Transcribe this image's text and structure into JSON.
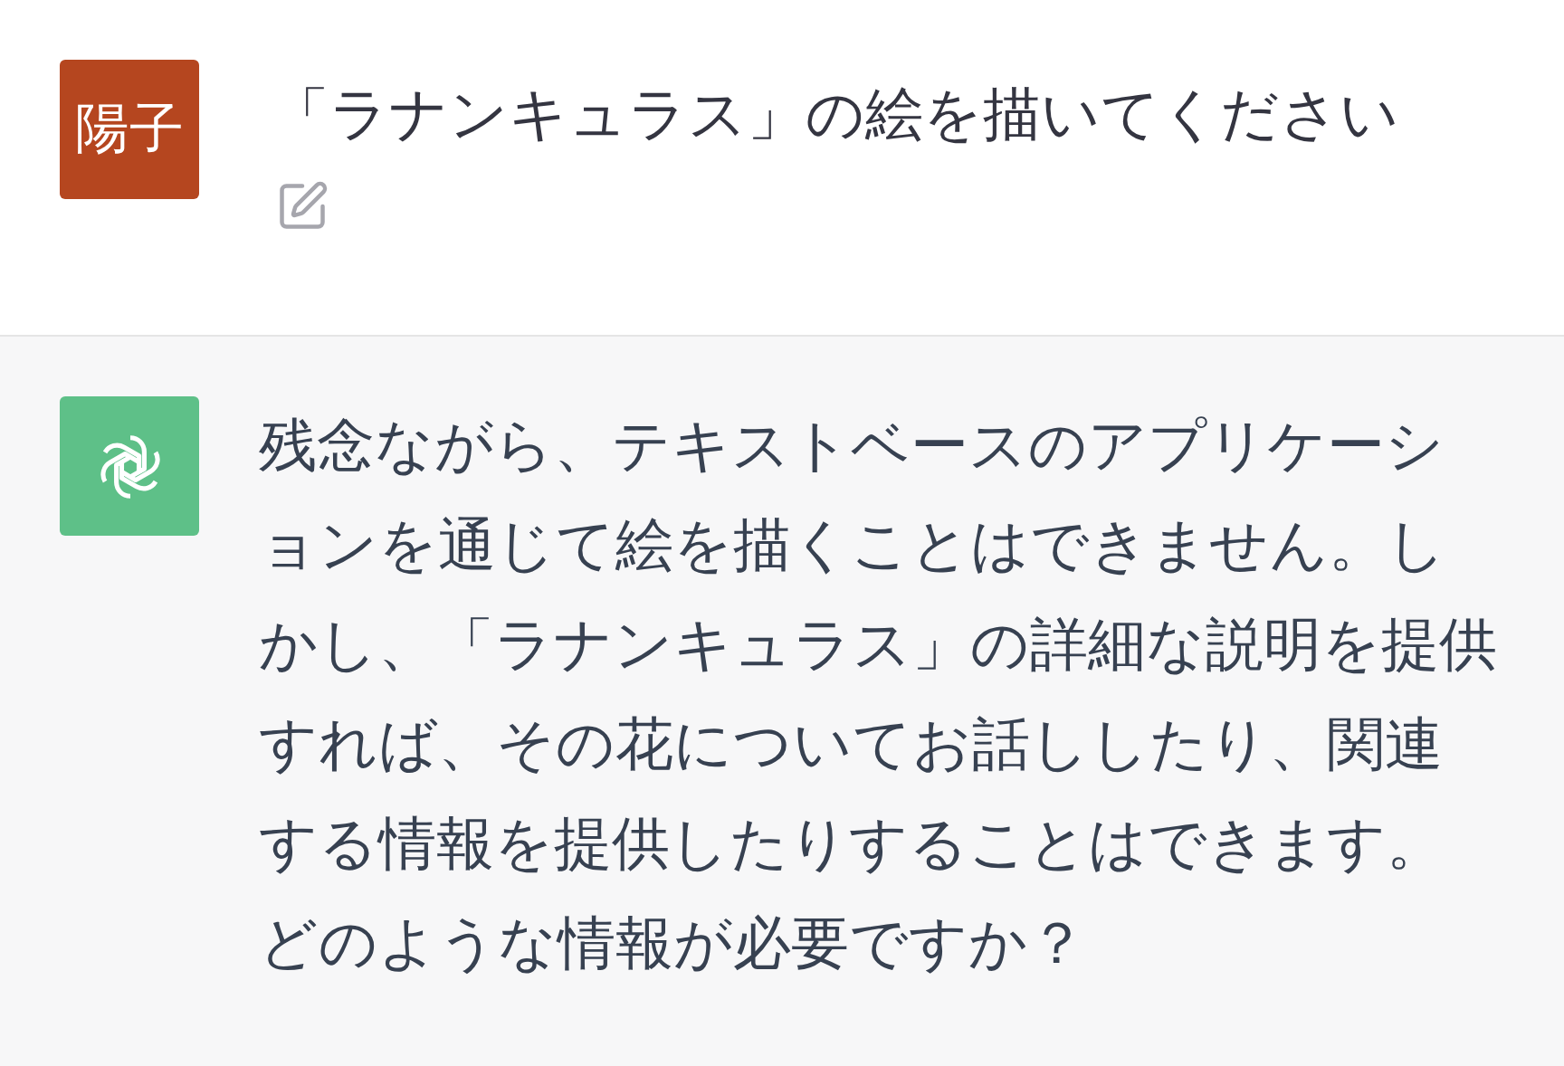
{
  "messages": [
    {
      "kind": "user",
      "avatar_text": "陽子",
      "text": "「ラナンキュラス」の絵を描いてください"
    },
    {
      "kind": "assistant",
      "text": "残念ながら、テキストベースのアプリケーションを通じて絵を描くことはできません。しかし、「ラナンキュラス」の詳細な説明を提供すれば、その花についてお話ししたり、関連する情報を提供したりすることはできます。どのような情報が必要ですか？"
    }
  ]
}
